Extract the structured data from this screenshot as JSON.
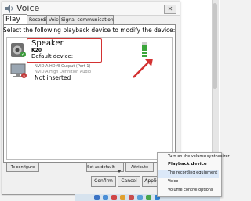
{
  "window": {
    "title": "Voice"
  },
  "tabs": [
    {
      "label": "Play"
    },
    {
      "label": "Recording"
    },
    {
      "label": "Voice"
    },
    {
      "label": "Signal communication"
    }
  ],
  "instruction": "Select the following playback device to modify the device:",
  "devices": {
    "primary": {
      "name": "Speaker",
      "model": "K20",
      "status": "Default device:"
    },
    "secondary": {
      "line1": "NVIDIA HDMI Output (Port 1)",
      "line2": "NVIDIA High Definition Audio",
      "status": "Not inserted"
    }
  },
  "level_meter": {
    "level": 0.75
  },
  "buttons": {
    "configure": "To configure",
    "set_default": "Set as default",
    "attribute": "Attribute",
    "confirm": "Confirm",
    "cancel": "Cancel",
    "application": "Application"
  },
  "context_menu": [
    {
      "label": "Turn on the volume synthesizer"
    },
    {
      "label": "Playback device"
    },
    {
      "label": "The recording equipment"
    },
    {
      "label": "Voice"
    },
    {
      "label": "Volume control options"
    }
  ],
  "colors": {
    "highlight": "#d33232",
    "meter": "#3aa63a",
    "selection": "#dbe8f8"
  }
}
